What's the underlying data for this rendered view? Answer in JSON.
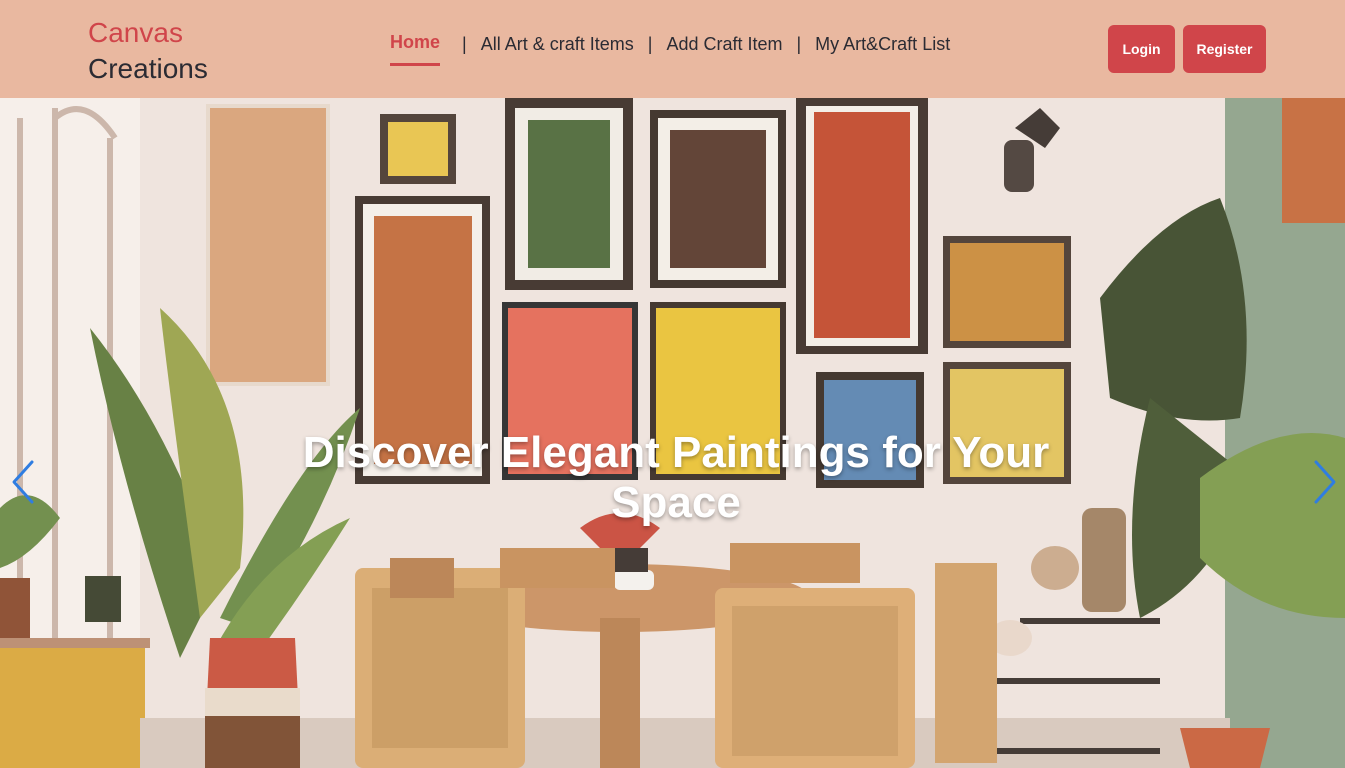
{
  "brand": {
    "line1": "Canvas",
    "line2": "Creations"
  },
  "nav": {
    "items": [
      {
        "label": "Home"
      },
      {
        "label": "All Art & craft Items"
      },
      {
        "label": "Add Craft Item"
      },
      {
        "label": "My Art&Craft List"
      }
    ],
    "separator": "|"
  },
  "auth": {
    "login_label": "Login",
    "register_label": "Register"
  },
  "hero": {
    "title": "Discover Elegant Paintings for Your Space"
  },
  "icons": {
    "prev": "chevron-left-icon",
    "next": "chevron-right-icon"
  },
  "colors": {
    "navbar_bg": "#e9b8a0",
    "accent": "#d0454a",
    "text_dark": "#2b2b33",
    "arrow": "#2f7de1"
  }
}
